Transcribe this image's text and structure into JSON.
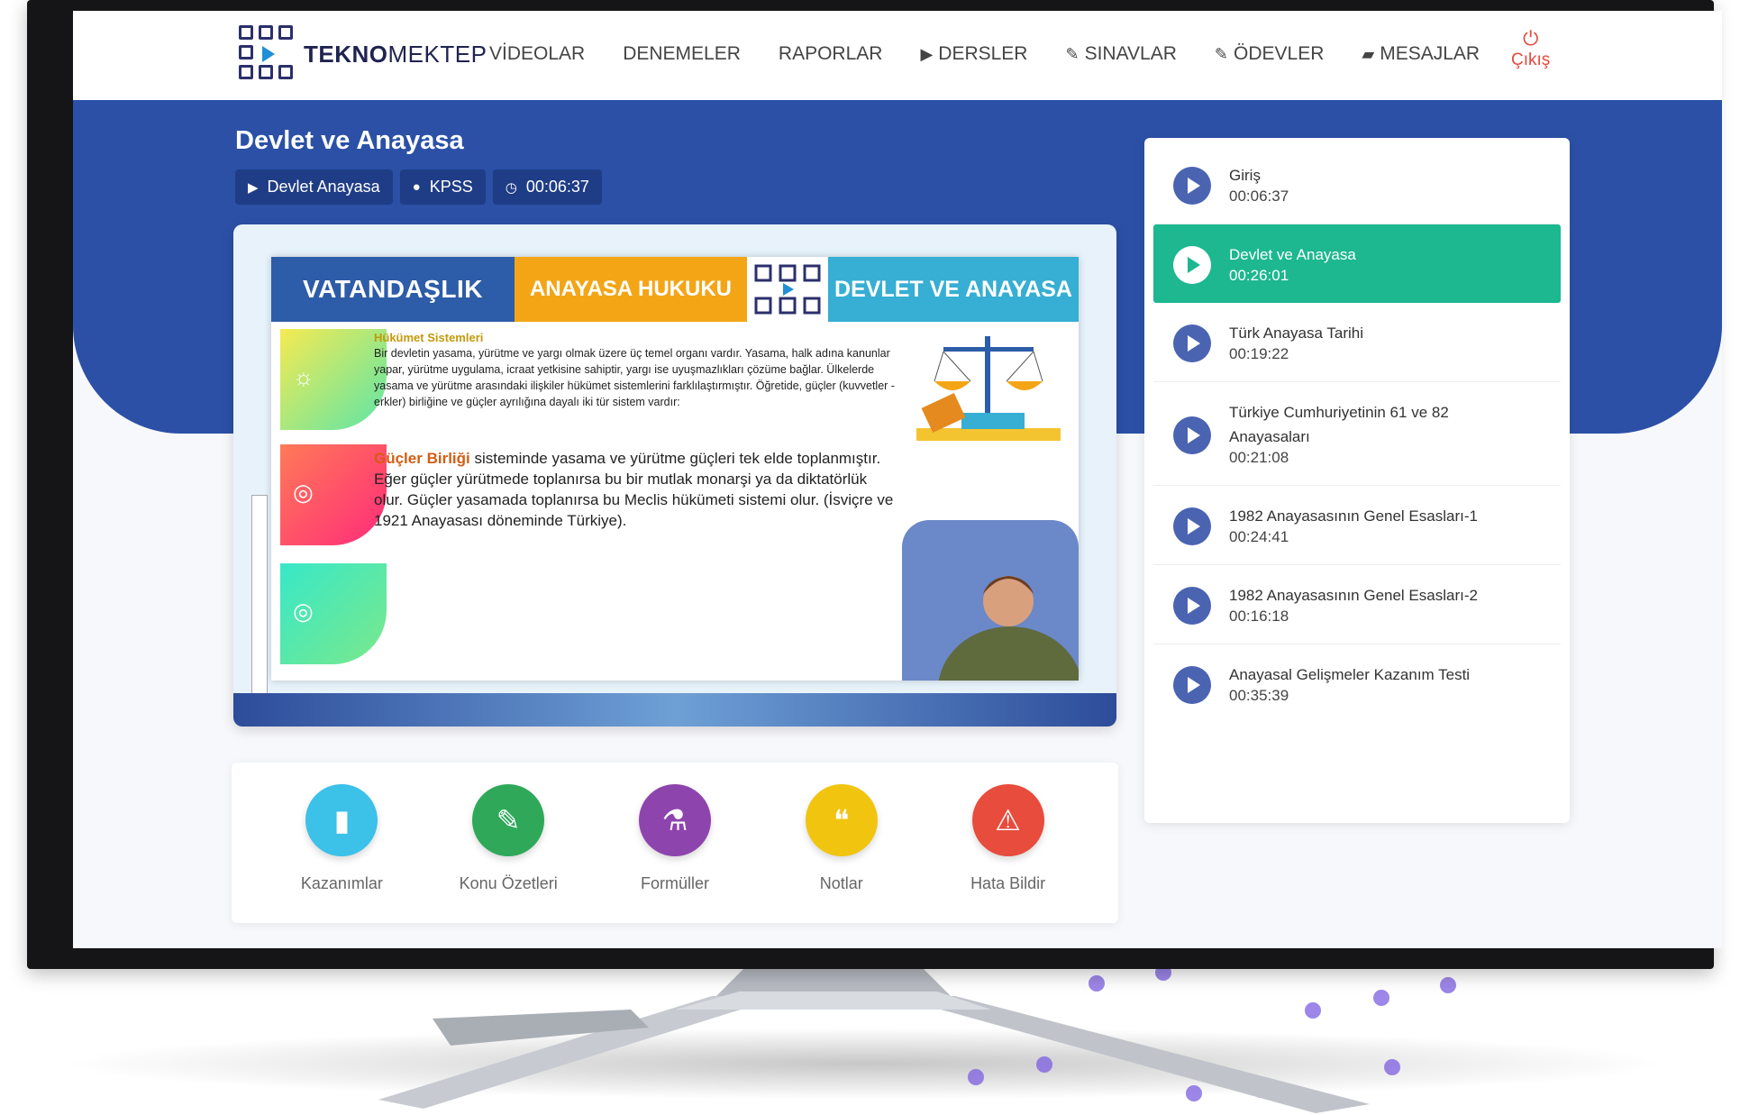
{
  "brand": {
    "logo_bold": "TEKNO",
    "logo_light": "MEKTEP"
  },
  "nav": [
    {
      "label": "VİDEOLAR",
      "icon": ""
    },
    {
      "label": "DENEMELER",
      "icon": ""
    },
    {
      "label": "RAPORLAR",
      "icon": ""
    },
    {
      "label": "DERSLER",
      "icon": "play-icon"
    },
    {
      "label": "SINAVLAR",
      "icon": "pencil-icon"
    },
    {
      "label": "ÖDEVLER",
      "icon": "pencil-icon"
    },
    {
      "label": "MESAJLAR",
      "icon": "message-icon"
    }
  ],
  "logout": {
    "label": "Çıkış",
    "icon": "power-icon"
  },
  "lesson": {
    "title": "Devlet ve Anayasa",
    "chips": [
      {
        "icon": "play-icon",
        "label": "Devlet Anayasa"
      },
      {
        "icon": "user-icon",
        "label": "KPSS"
      },
      {
        "icon": "clock-icon",
        "label": "00:06:37"
      }
    ]
  },
  "slide": {
    "head": [
      "VATANDAŞLIK",
      "ANAYASA HUKUKU",
      "DEVLET VE ANAYASA"
    ],
    "subheading": "Hükümet Sistemleri",
    "para1": "Bir devletin yasama, yürütme ve yargı olmak üzere üç temel organı vardır. Yasama, halk adına kanunlar yapar, yürütme uygulama, icraat yetkisine sahiptir, yargı ise uyuşmazlıkları çözüme bağlar. Ülkelerde yasama ve yürütme arasındaki ilişkiler hükümet sistemlerini farklılaştırmıştır. Öğretide, güçler (kuvvetler -erkler) birliğine ve güçler ayrılığına dayalı iki tür sistem vardır:",
    "para2_bold": "Güçler Birliği",
    "para2": " sisteminde yasama ve yürütme güçleri tek elde toplanmıştır. Eğer güçler yürütmede toplanırsa bu bir mutlak monarşi ya da diktatörlük olur. Güçler yasamada toplanırsa bu Meclis hükümeti sistemi olur. (İsviçre ve 1921 Anayasası döneminde Türkiye)."
  },
  "tools": [
    {
      "label": "Kazanımlar",
      "icon": "document-icon",
      "color": "#3cc1e8",
      "glyph": "▮"
    },
    {
      "label": "Konu Özetleri",
      "icon": "pencil-icon",
      "color": "#2fa85a",
      "glyph": "✎"
    },
    {
      "label": "Formüller",
      "icon": "flask-icon",
      "color": "#8e44ad",
      "glyph": "⚗"
    },
    {
      "label": "Notlar",
      "icon": "chat-icon",
      "color": "#f1c40f",
      "glyph": "💬"
    },
    {
      "label": "Hata Bildir",
      "icon": "warning-icon",
      "color": "#e74c3c",
      "glyph": "⚠"
    }
  ],
  "playlist": [
    {
      "title": "Giriş",
      "duration": "00:06:37",
      "active": false
    },
    {
      "title": "Devlet ve Anayasa",
      "duration": "00:26:01",
      "active": true
    },
    {
      "title": "Türk Anayasa Tarihi",
      "duration": "00:19:22",
      "active": false
    },
    {
      "title": "Türkiye Cumhuriyetinin 61 ve 82 Anayasaları",
      "duration": "00:21:08",
      "active": false
    },
    {
      "title": "1982 Anayasasının Genel Esasları-1",
      "duration": "00:24:41",
      "active": false
    },
    {
      "title": "1982 Anayasasının Genel Esasları-2",
      "duration": "00:16:18",
      "active": false
    },
    {
      "title": "Anayasal Gelişmeler Kazanım Testi",
      "duration": "00:35:39",
      "active": false
    }
  ],
  "colors": {
    "band": "#2b50a6",
    "active": "#1db790",
    "logout": "#e5483c"
  }
}
